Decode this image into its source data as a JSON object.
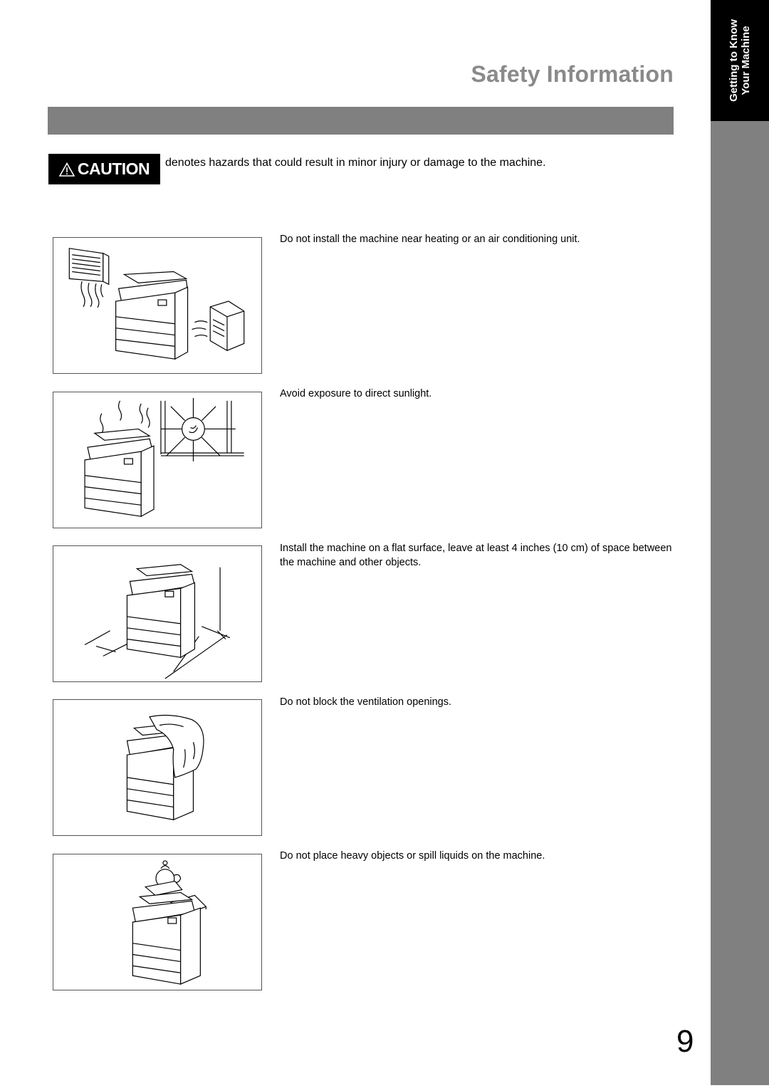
{
  "header": {
    "title": "Safety Information"
  },
  "side_tab": {
    "line1": "Getting to Know",
    "line2": "Your Machine"
  },
  "caution": {
    "label": "CAUTION",
    "icon": "warning-triangle-icon",
    "description": "denotes hazards that could result in minor injury or damage to the machine."
  },
  "items": [
    {
      "illustration": "machine-near-heater-and-air-conditioner",
      "text": "Do not install the machine near heating or an air conditioning unit."
    },
    {
      "illustration": "machine-in-direct-sunlight",
      "text": "Avoid exposure to direct sunlight."
    },
    {
      "illustration": "machine-clearance-space",
      "text": "Install the machine on a flat surface, leave at least 4 inches (10 cm) of space between the machine and other objects."
    },
    {
      "illustration": "machine-covered-by-cloth",
      "text": "Do not block the ventilation openings."
    },
    {
      "illustration": "machine-with-objects-on-top",
      "text": "Do not place heavy objects or spill liquids on the machine."
    }
  ],
  "footer": {
    "page_number": "9"
  }
}
